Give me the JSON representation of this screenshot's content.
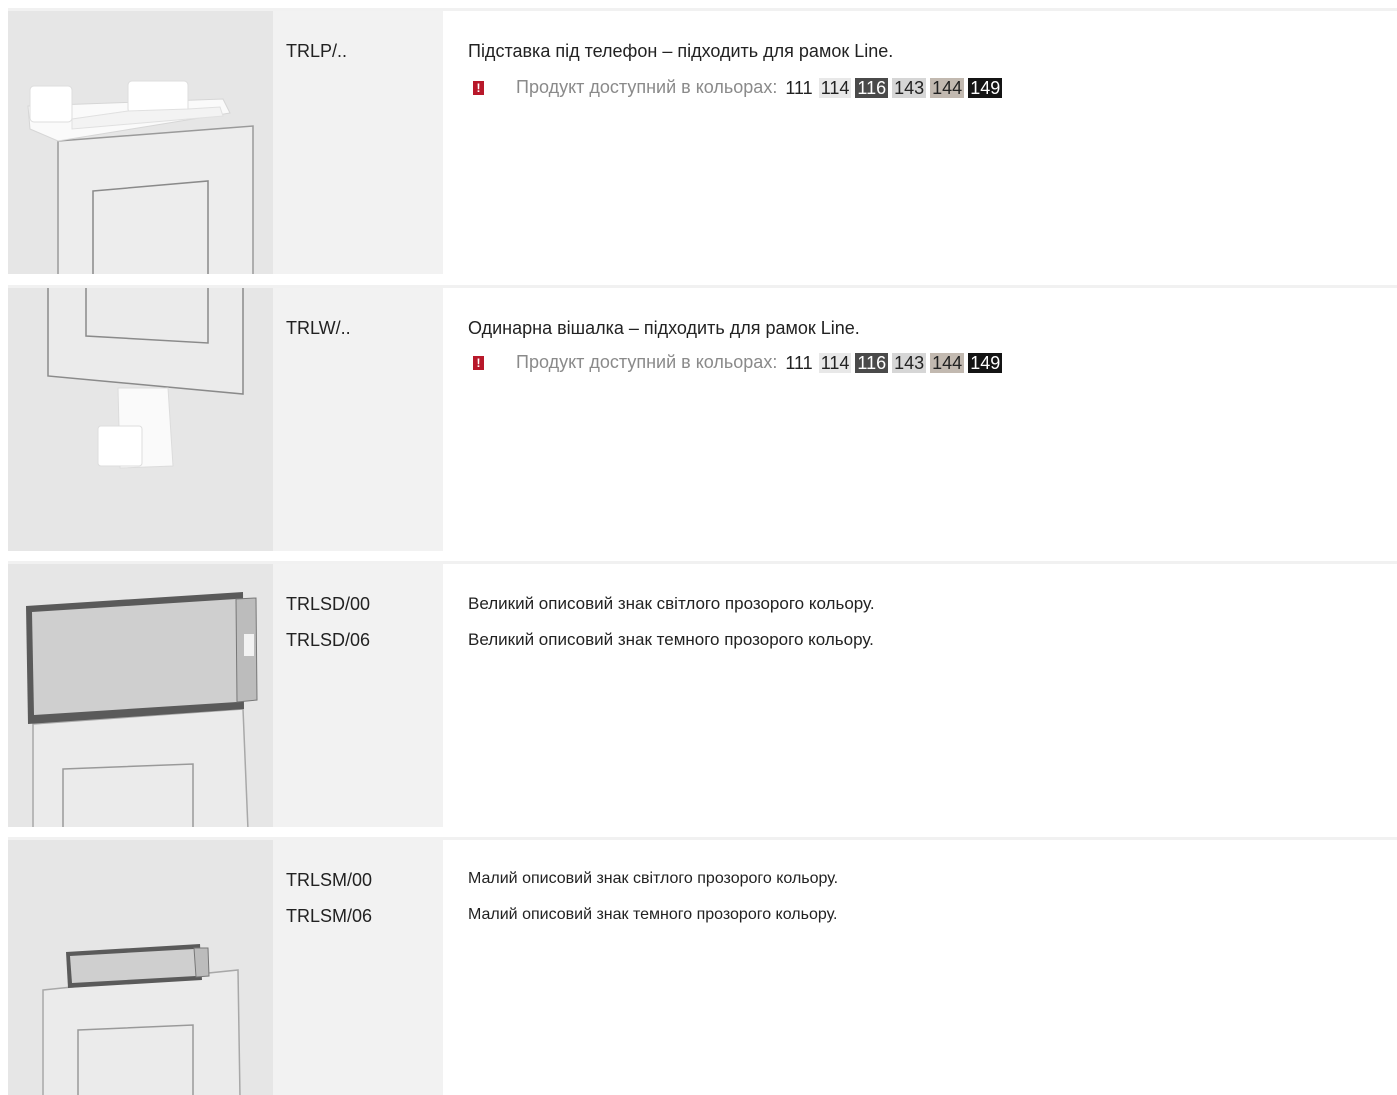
{
  "products": [
    {
      "codes": [
        "TRLP/.."
      ],
      "descriptions": [
        "Підставка під телефон – підходить для рамок Line."
      ],
      "availability": {
        "label": "Продукт доступний в кольорах:",
        "colors": [
          {
            "code": "111",
            "bg": "#ffffff",
            "fg": "#222222"
          },
          {
            "code": "114",
            "bg": "#e8e8e8",
            "fg": "#222222"
          },
          {
            "code": "116",
            "bg": "#4a4a4a",
            "fg": "#ffffff"
          },
          {
            "code": "143",
            "bg": "#d6d6d6",
            "fg": "#222222"
          },
          {
            "code": "144",
            "bg": "#c2b9b0",
            "fg": "#222222"
          },
          {
            "code": "149",
            "bg": "#141414",
            "fg": "#ffffff"
          }
        ]
      },
      "image_icon": "phone-stand-illustration"
    },
    {
      "codes": [
        "TRLW/.."
      ],
      "descriptions": [
        "Одинарна вішалка – підходить для рамок Line."
      ],
      "availability": {
        "label": "Продукт доступний в кольорах:",
        "colors": [
          {
            "code": "111",
            "bg": "#ffffff",
            "fg": "#222222"
          },
          {
            "code": "114",
            "bg": "#e8e8e8",
            "fg": "#222222"
          },
          {
            "code": "116",
            "bg": "#4a4a4a",
            "fg": "#ffffff"
          },
          {
            "code": "143",
            "bg": "#d6d6d6",
            "fg": "#222222"
          },
          {
            "code": "144",
            "bg": "#c2b9b0",
            "fg": "#222222"
          },
          {
            "code": "149",
            "bg": "#141414",
            "fg": "#ffffff"
          }
        ]
      },
      "image_icon": "hook-illustration"
    },
    {
      "codes": [
        "TRLSD/00",
        "TRLSD/06"
      ],
      "descriptions": [
        "Великий описовий знак світлого прозорого кольору.",
        "Великий описовий знак темного прозорого кольору."
      ],
      "image_icon": "large-label-illustration"
    },
    {
      "codes": [
        "TRLSM/00",
        "TRLSM/06"
      ],
      "descriptions": [
        "Малий описовий знак світлого прозорого кольору.",
        "Малий описовий знак темного прозорого кольору."
      ],
      "image_icon": "small-label-illustration"
    }
  ],
  "colors": {
    "warning": "#b8182a",
    "image_bg": "#e6e6e6",
    "code_bg": "#f2f2f2",
    "row_border": "#f1f1f1"
  }
}
